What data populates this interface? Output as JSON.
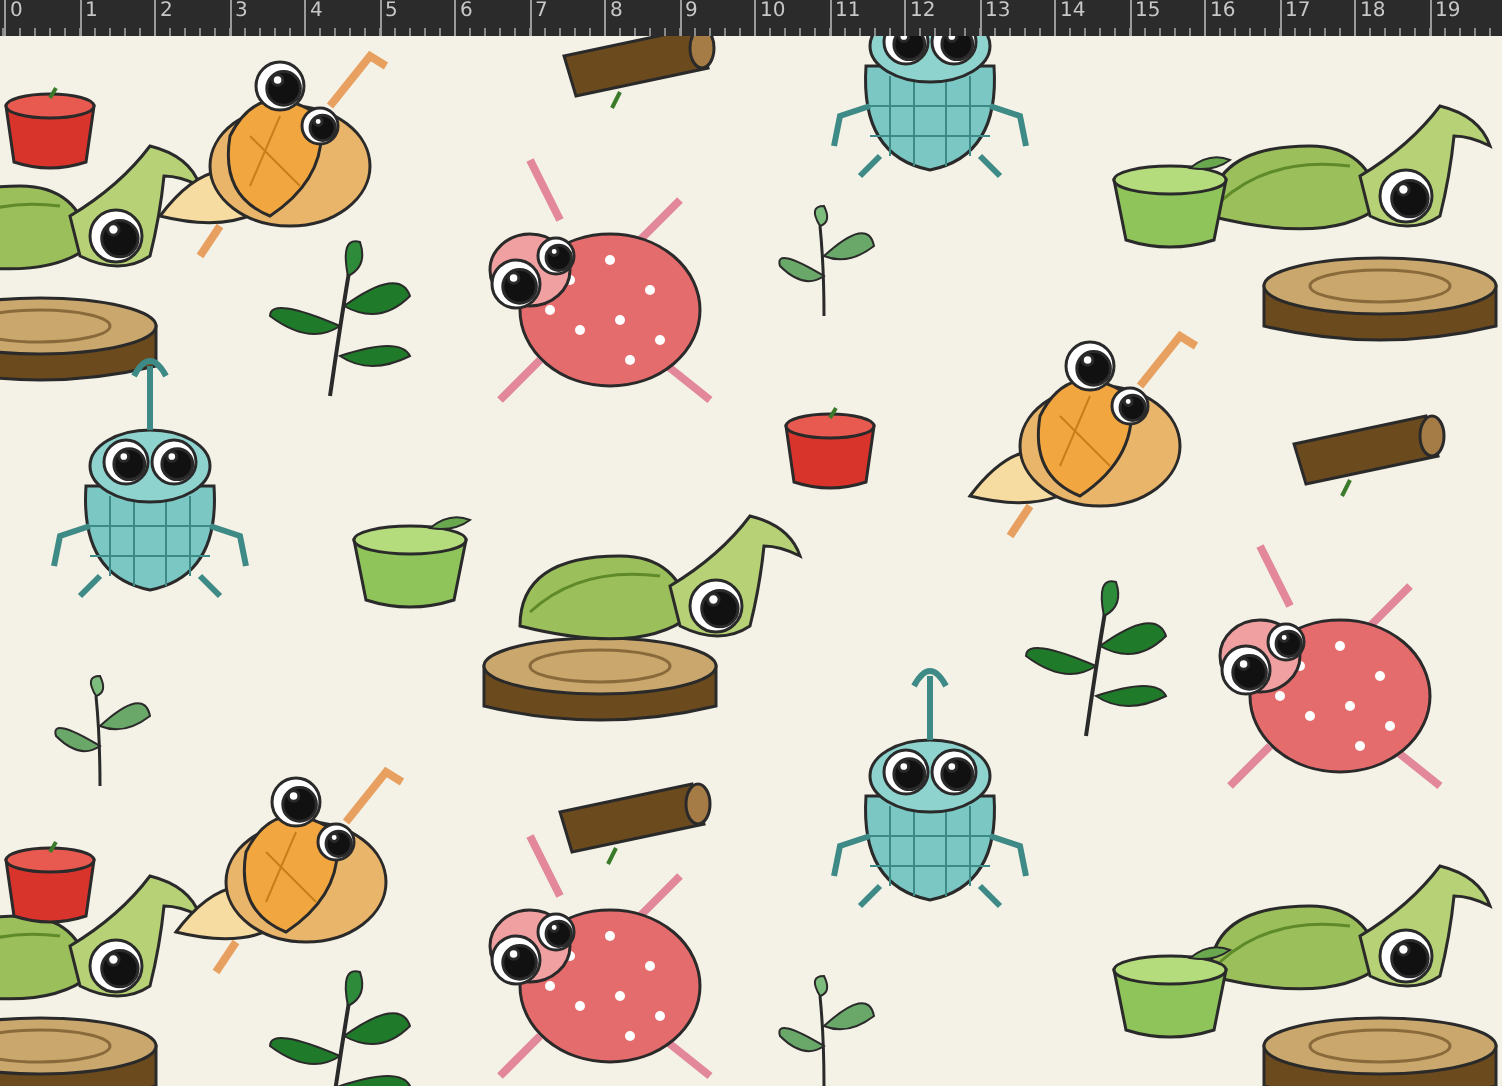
{
  "ruler": {
    "labels": [
      "0",
      "1",
      "2",
      "3",
      "4",
      "5",
      "6",
      "7",
      "8",
      "9",
      "10",
      "11",
      "12",
      "13",
      "14",
      "15",
      "16",
      "17",
      "18",
      "19"
    ]
  }
}
